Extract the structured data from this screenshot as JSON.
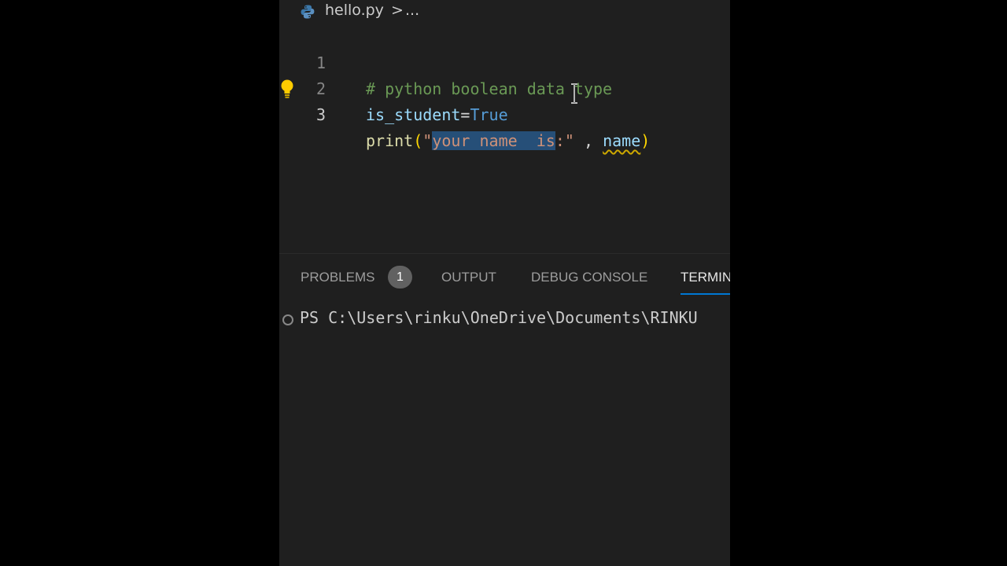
{
  "breadcrumb": {
    "file": "hello.py",
    "separator": ">",
    "more": "..."
  },
  "editor": {
    "lines": [
      {
        "number": "1",
        "comment": "# python boolean data type"
      },
      {
        "number": "2",
        "var": "is_student",
        "op": "=",
        "const": "True"
      },
      {
        "number": "3",
        "fn": "print",
        "paren_open": "(",
        "quote_open": "\"",
        "selected": "your name  is",
        "str_rest": ":\"",
        "comma": " , ",
        "arg": "name",
        "paren_close": ")"
      }
    ],
    "lightbulb_icon": "lightbulb-icon",
    "cursor_icon": "text-cursor-icon"
  },
  "panel": {
    "tabs": [
      {
        "label": "PROBLEMS",
        "badge": "1"
      },
      {
        "label": "OUTPUT"
      },
      {
        "label": "DEBUG CONSOLE"
      },
      {
        "label": "TERMIN",
        "active": true
      }
    ]
  },
  "terminal": {
    "prompt": "PS C:\\Users\\rinku\\OneDrive\\Documents\\RINKU"
  },
  "colors": {
    "background": "#1f1f1f",
    "selection": "#264f78",
    "active_tab_underline": "#0078d4",
    "badge": "#616161"
  }
}
